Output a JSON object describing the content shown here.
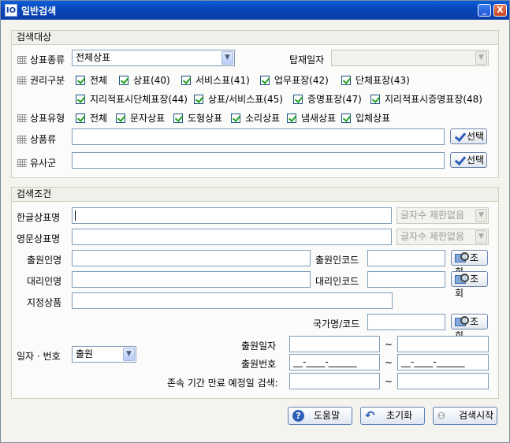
{
  "window": {
    "icon_text": "IO",
    "title": "일반검색",
    "minimize_glyph": "_",
    "close_glyph": "X"
  },
  "target": {
    "header": "검색대상",
    "mark_type": {
      "label": "상표종류",
      "value": "전체상표"
    },
    "pub_date": {
      "label": "탑재일자",
      "value": ""
    },
    "right_class": {
      "label": "권리구분",
      "options": [
        {
          "label": "전체",
          "checked": true
        },
        {
          "label": "상표(40)",
          "checked": true
        },
        {
          "label": "서비스표(41)",
          "checked": true
        },
        {
          "label": "업무표장(42)",
          "checked": true
        },
        {
          "label": "단체표장(43)",
          "checked": true
        },
        {
          "label": "지리적표시단체표장(44)",
          "checked": true
        },
        {
          "label": "상표/서비스표(45)",
          "checked": true
        },
        {
          "label": "증명표장(47)",
          "checked": true
        },
        {
          "label": "지리적표시증명표장(48)",
          "checked": true
        }
      ]
    },
    "mark_kind": {
      "label": "상표유형",
      "options": [
        {
          "label": "전체",
          "checked": true
        },
        {
          "label": "문자상표",
          "checked": true
        },
        {
          "label": "도형상표",
          "checked": true
        },
        {
          "label": "소리상표",
          "checked": true
        },
        {
          "label": "냄새상표",
          "checked": true
        },
        {
          "label": "입체상표",
          "checked": true
        }
      ]
    },
    "goods_class": {
      "label": "상품류",
      "value": "",
      "button": "선택"
    },
    "similar_group": {
      "label": "유사군",
      "value": "",
      "button": "선택"
    }
  },
  "conditions": {
    "header": "검색조건",
    "kor_name": {
      "label": "한글상표명",
      "value": "",
      "limit": "글자수 제한없음"
    },
    "eng_name": {
      "label": "영문상표명",
      "value": "",
      "limit": "글자수 제한없음"
    },
    "applicant": {
      "label": "출원인명",
      "value": "",
      "code_label": "출원인코드",
      "code_value": "",
      "button": "조회"
    },
    "agent": {
      "label": "대리인명",
      "value": "",
      "code_label": "대리인코드",
      "code_value": "",
      "button": "조회"
    },
    "designated_goods": {
      "label": "지정상품",
      "value": ""
    },
    "country": {
      "label": "국가명/코드",
      "value": "",
      "button": "조회"
    },
    "date_number": {
      "label": "일자 · 번호",
      "select_value": "출원",
      "app_date_label": "출원일자",
      "app_date_from": "",
      "app_date_to": "",
      "app_no_label": "출원번호",
      "app_no_from": "__-____-______",
      "app_no_to": "__-____-______",
      "expiry_label": "존속 기간 만료 예정일 검색:",
      "expiry_from": "",
      "expiry_to": "",
      "tilde": "~"
    }
  },
  "footer": {
    "help": "도움말",
    "reset": "초기화",
    "search": "검색시작"
  }
}
